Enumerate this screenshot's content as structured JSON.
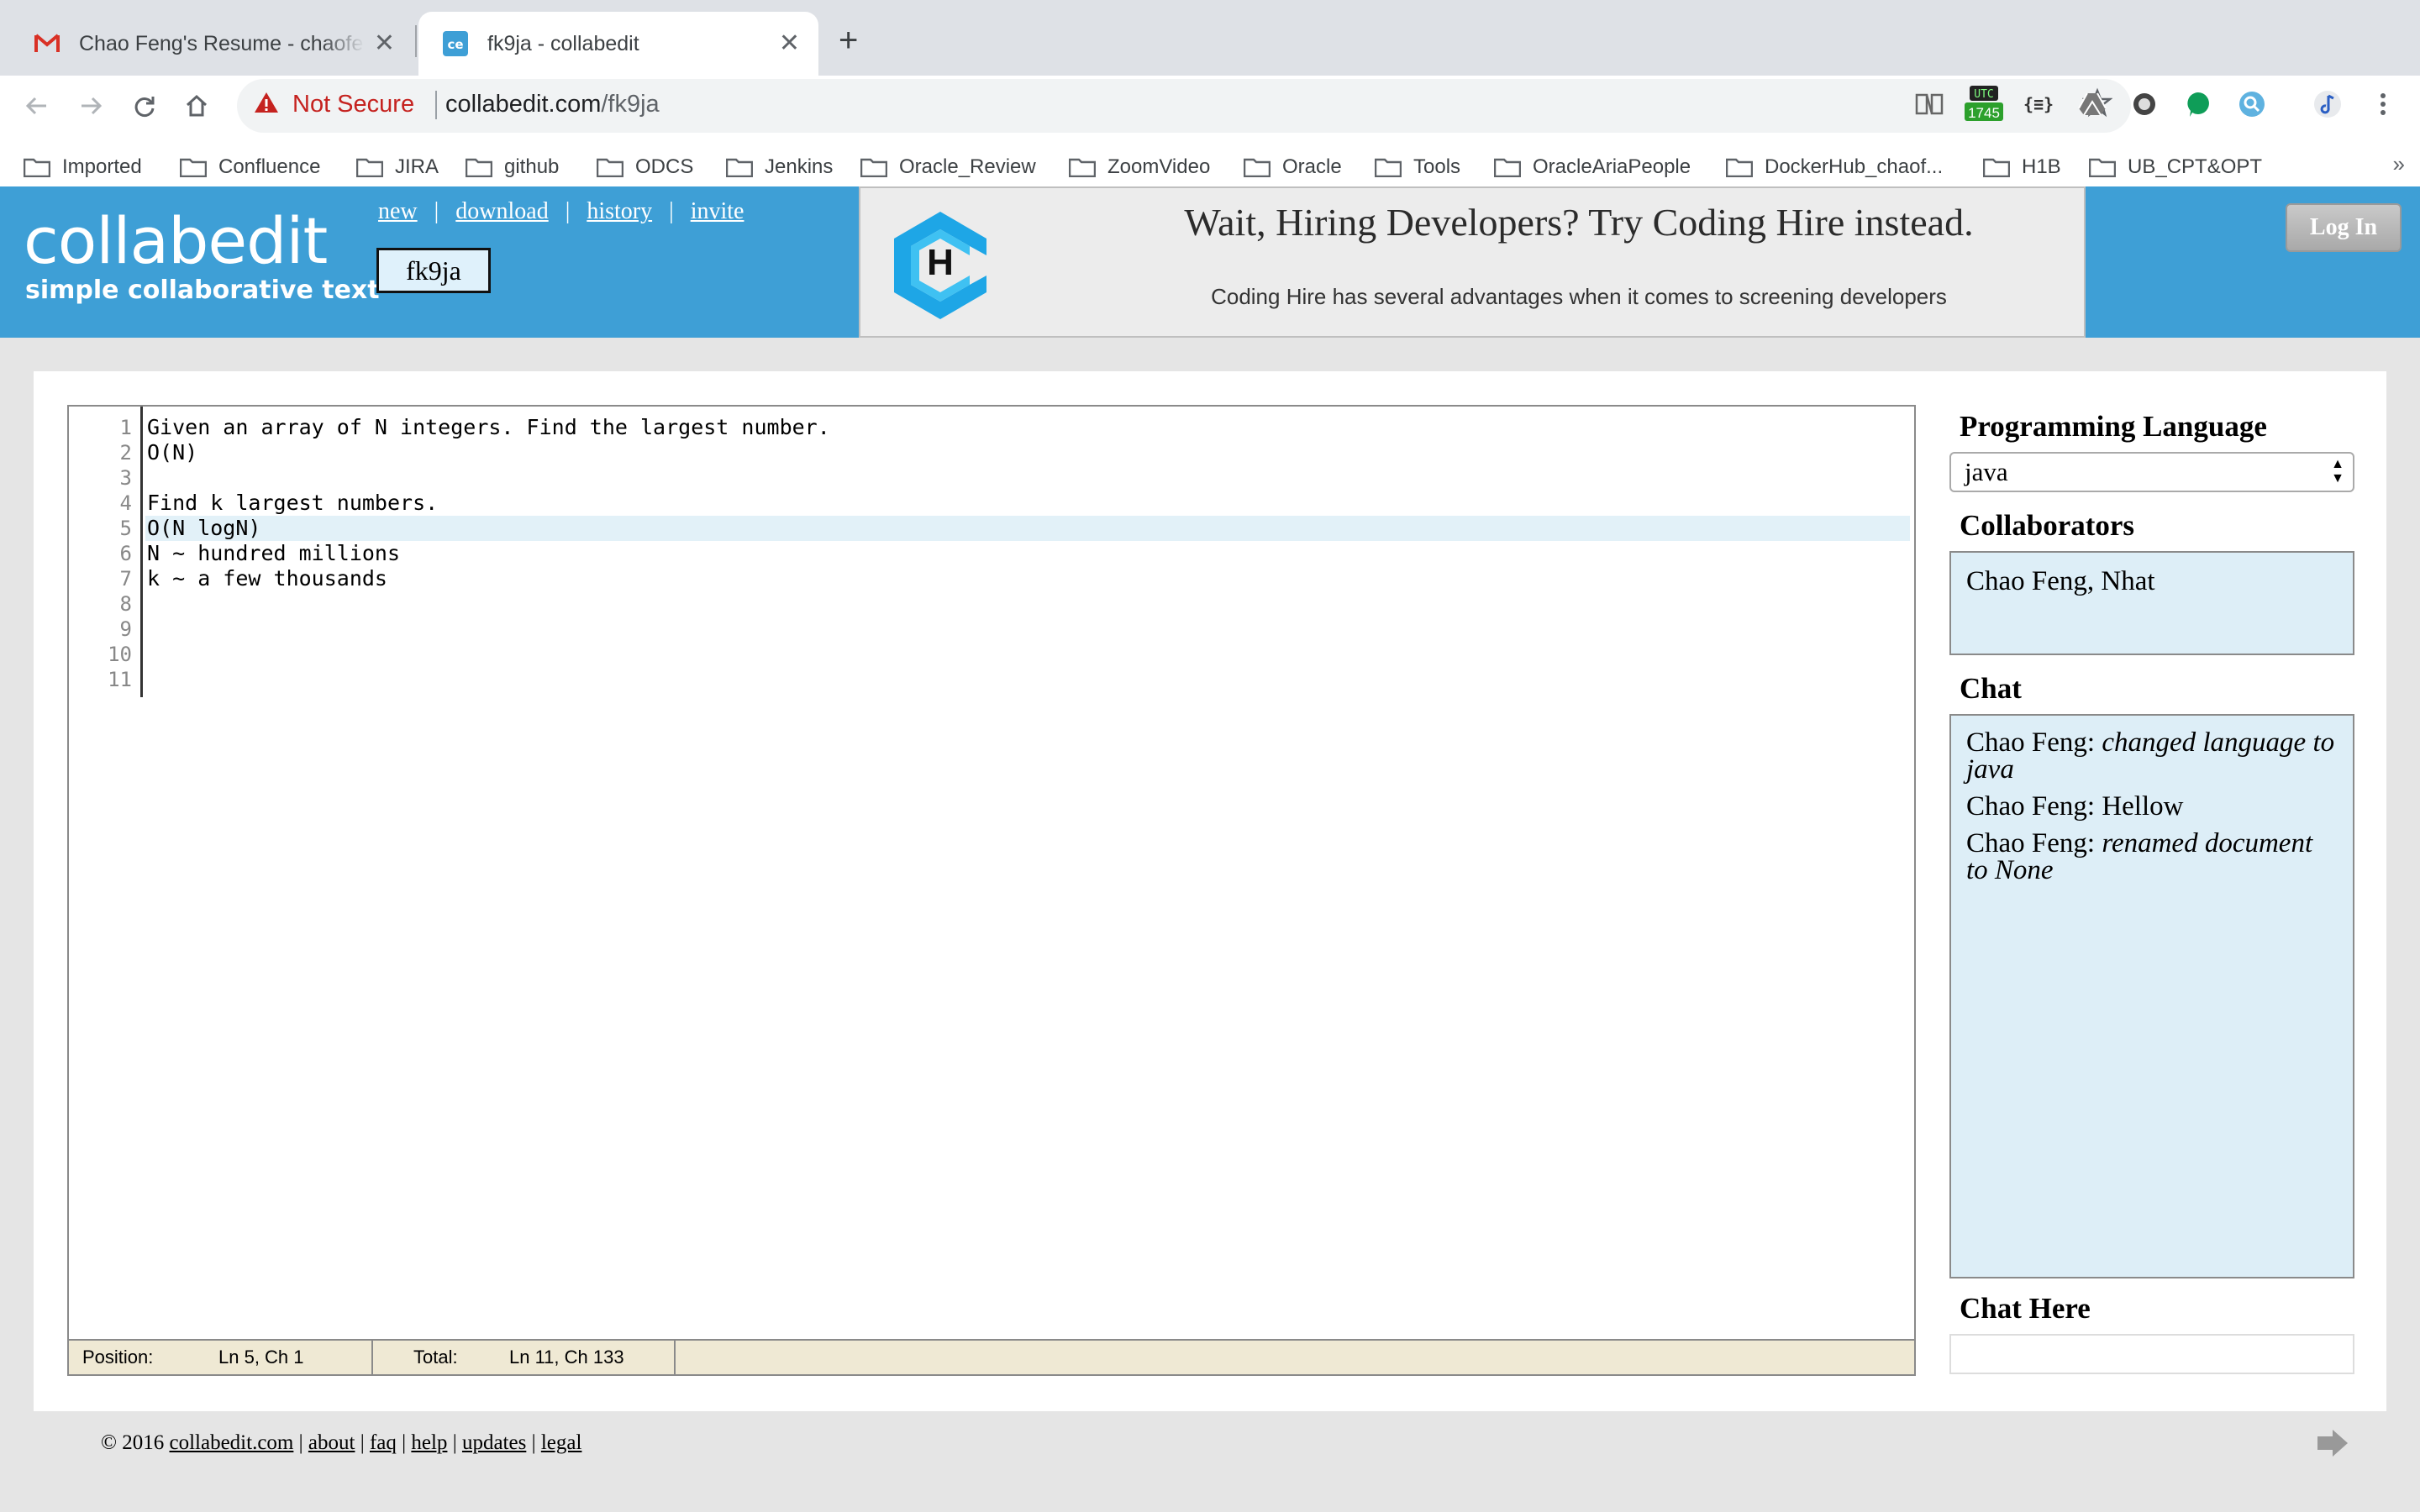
{
  "browser": {
    "tabs": [
      {
        "title": "Chao Feng's Resume - chaofeng",
        "icon": "gmail-icon",
        "active": false
      },
      {
        "title": "fk9ja - collabedit",
        "icon": "collabedit-icon",
        "active": true
      }
    ],
    "new_tab": "+",
    "close_glyph": "✕",
    "security_label": "Not Secure",
    "url_host": "collabedit.com",
    "url_path": "/fk9ja",
    "extensions": [
      "reader-icon",
      "utc-clock-icon",
      "json-icon",
      "drive-icon",
      "circle-icon",
      "hangouts-icon",
      "search-ext-icon",
      "music-icon",
      "menu-icon"
    ],
    "utc_badge": "1745",
    "utc_label": "UTC",
    "json_label": "{≡}",
    "bookmarks": [
      "Imported",
      "Confluence",
      "JIRA",
      "github",
      "ODCS",
      "Jenkins",
      "Oracle_Review",
      "ZoomVideo",
      "Oracle",
      "Tools",
      "OracleAriaPeople",
      "DockerHub_chaof...",
      "H1B",
      "UB_CPT&OPT"
    ],
    "bookmarks_more": "»"
  },
  "site": {
    "logo": "collabedit",
    "tagline": "simple collaborative text",
    "links": [
      "new",
      "download",
      "history",
      "invite"
    ],
    "link_separator": "|",
    "doc_name": "fk9ja",
    "login_label": "Log In",
    "ad": {
      "title": "Wait, Hiring Developers? Try Coding Hire instead.",
      "subtitle": "Coding Hire has several advantages when it comes to screening developers",
      "logo_letter": "H"
    }
  },
  "editor": {
    "line_numbers": [
      "1",
      "2",
      "3",
      "4",
      "5",
      "6",
      "7",
      "8",
      "9",
      "10",
      "11"
    ],
    "lines": [
      "Given an array of N integers. Find the largest number.",
      "O(N)",
      "",
      "Find k largest numbers.",
      "O(N logN)",
      "N ~ hundred millions",
      "k ~ a few thousands",
      "",
      "",
      "",
      ""
    ],
    "current_line": 5,
    "status": {
      "position_label": "Position:",
      "position_value": "Ln 5, Ch 1",
      "total_label": "Total:",
      "total_value": "Ln 11, Ch 133"
    }
  },
  "sidebar": {
    "language_heading": "Programming Language",
    "language_value": "java",
    "collaborators_heading": "Collaborators",
    "collaborators": "Chao Feng, Nhat",
    "chat_heading": "Chat",
    "chat_messages": [
      {
        "author": "Chao Feng:",
        "text": "changed language to java",
        "italic": true
      },
      {
        "author": "Chao Feng:",
        "text": "Hellow",
        "italic": false
      },
      {
        "author": "Chao Feng:",
        "text": "renamed document to None",
        "italic": true
      }
    ],
    "chat_input_heading": "Chat Here",
    "chat_input_value": ""
  },
  "footer": {
    "copyright": "© 2016",
    "links": [
      "collabedit.com",
      "about",
      "faq",
      "help",
      "updates",
      "legal"
    ],
    "separator": "|"
  },
  "colors": {
    "header_blue": "#3e9fd6",
    "not_secure_red": "#c5221f",
    "current_line": "#e2f1f8",
    "panel_blue": "#ddeef7",
    "status_bar": "#efe9d4"
  }
}
